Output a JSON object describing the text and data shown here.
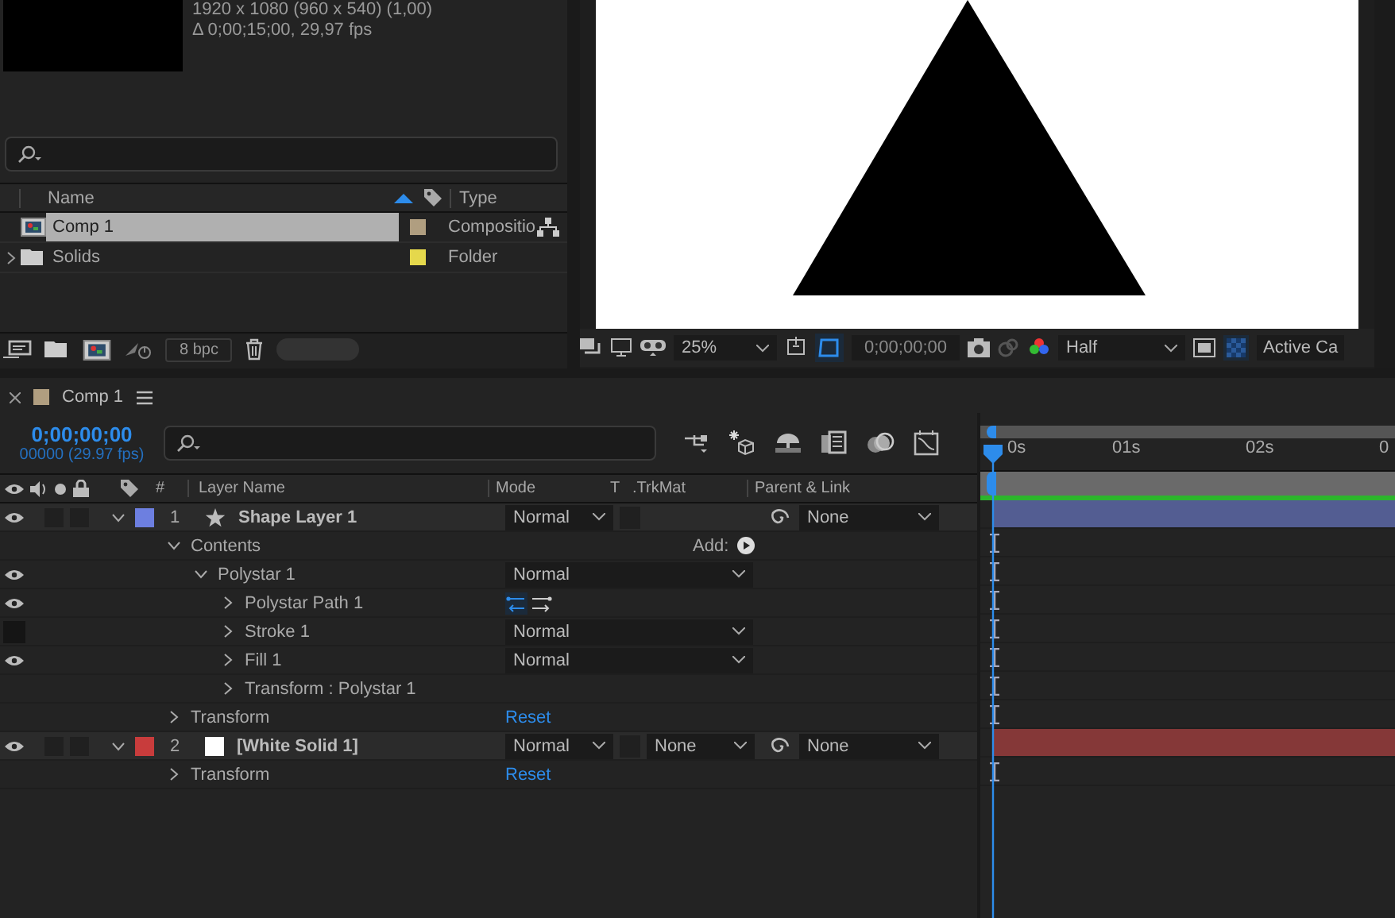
{
  "project": {
    "info_lines": [
      "1920 x 1080  (960 x 540) (1,00)",
      "Δ 0;00;15;00, 29,97 fps"
    ],
    "columns": {
      "name": "Name",
      "type": "Type"
    },
    "items": [
      {
        "name": "Comp 1",
        "kind": "composition",
        "color": "#b09e80",
        "type": "Compositio",
        "selected": true
      },
      {
        "name": "Solids",
        "kind": "folder",
        "color": "#e5d84c",
        "type": "Folder",
        "selected": false
      }
    ],
    "bpc": "8 bpc"
  },
  "viewer": {
    "zoom": "25%",
    "timecode": "0;00;00;00",
    "resolution": "Half",
    "camera": "Active Ca"
  },
  "timeline": {
    "tab": {
      "title": "Comp 1",
      "color": "#b09e80"
    },
    "current_time": "0;00;00;00",
    "frame_info": "00000 (29.97 fps)",
    "columns": {
      "number": "#",
      "layer_name": "Layer Name",
      "mode": "Mode",
      "track_matte_t": "T",
      "track_matte": ".TrkMat",
      "parent": "Parent & Link"
    },
    "ruler": [
      "0s",
      "01s",
      "02s",
      "0"
    ],
    "layers": [
      {
        "number": "1",
        "kind": "shape",
        "name": "Shape Layer 1",
        "color": "#6d7fe0",
        "visible": true,
        "expanded": true,
        "mode": "Normal",
        "parent": "None",
        "children": [
          {
            "name": "Contents",
            "expanded": true,
            "value": {
              "kind": "add",
              "text": "Add:"
            },
            "children": [
              {
                "name": "Polystar 1",
                "visible": true,
                "expanded": true,
                "value": {
                  "kind": "dropdown",
                  "text": "Normal"
                },
                "children": [
                  {
                    "name": "Polystar Path 1",
                    "visible": true,
                    "expanded": false,
                    "value": {
                      "kind": "path_direction"
                    }
                  },
                  {
                    "name": "Stroke 1",
                    "visible": false,
                    "expanded": false,
                    "value": {
                      "kind": "dropdown",
                      "text": "Normal"
                    }
                  },
                  {
                    "name": "Fill 1",
                    "visible": true,
                    "expanded": false,
                    "value": {
                      "kind": "dropdown",
                      "text": "Normal"
                    }
                  },
                  {
                    "name": "Transform : Polystar 1",
                    "expanded": false
                  }
                ]
              }
            ]
          },
          {
            "name": "Transform",
            "expanded": false,
            "value": {
              "kind": "reset",
              "text": "Reset"
            }
          }
        ]
      },
      {
        "number": "2",
        "kind": "solid",
        "name": "[White Solid 1]",
        "color": "#c83c3c",
        "visible": true,
        "expanded": true,
        "mode": "Normal",
        "track_matte": "None",
        "parent": "None",
        "children": [
          {
            "name": "Transform",
            "expanded": false,
            "value": {
              "kind": "reset",
              "text": "Reset"
            }
          }
        ]
      }
    ]
  }
}
